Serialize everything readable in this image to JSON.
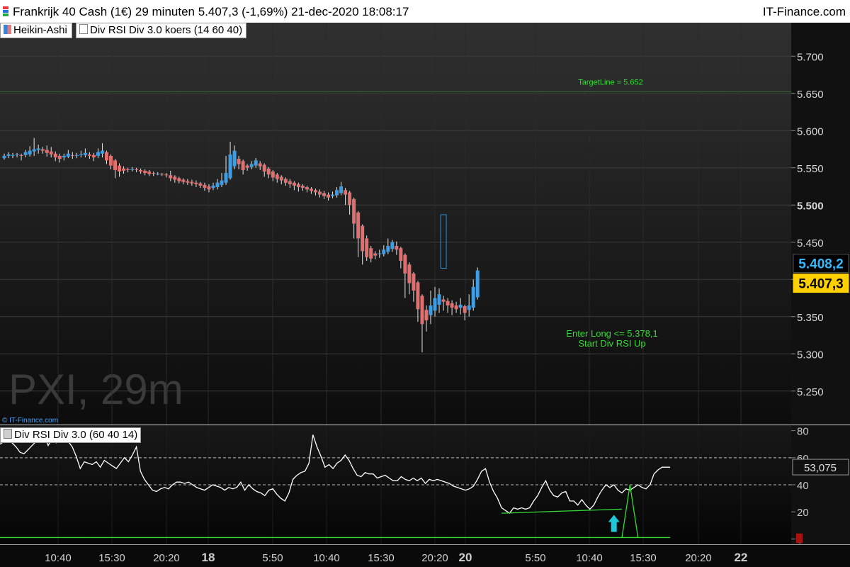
{
  "header": {
    "title": "Frankrijk 40 Cash (1€) 29 minuten 5.407,3 (-1,69%) 21-dec-2020 18:08:17",
    "brand": "IT-Finance.com"
  },
  "legend": {
    "heikin": "Heikin-Ashi",
    "divrsi_main": "Div RSI Div 3.0 koers (14 60 40)",
    "divrsi_sub": "Div RSI Div 3.0 (60 40 14)"
  },
  "watermark": "PXI, 29m",
  "copyright": "© IT-Finance.com",
  "colors": {
    "up": "#3d9ee6",
    "down": "#e07070",
    "wick": "#e6e6e6",
    "signal": "#33dd33",
    "current_price_bg": "#ffd000",
    "last_price_fg": "#33bbff",
    "arrow": "#1ec8d8",
    "rsi_line": "#ffffff"
  },
  "chart_data": [
    {
      "type": "candlestick",
      "title": "Frankrijk 40 Cash (1€) 29 minuten",
      "ylim": [
        5.205,
        5.745
      ],
      "yticks": [
        {
          "v": 5.25,
          "label": "5.250"
        },
        {
          "v": 5.3,
          "label": "5.300"
        },
        {
          "v": 5.35,
          "label": "5.350"
        },
        {
          "v": 5.4,
          "label": ""
        },
        {
          "v": 5.45,
          "label": "5.450"
        },
        {
          "v": 5.5,
          "label": "5.500"
        },
        {
          "v": 5.55,
          "label": "5.550"
        },
        {
          "v": 5.6,
          "label": "5.600"
        },
        {
          "v": 5.65,
          "label": "5.650"
        },
        {
          "v": 5.7,
          "label": "5.700"
        }
      ],
      "xticks": [
        "10:40",
        "15:30",
        "20:20",
        "18",
        "5:50",
        "10:40",
        "15:30",
        "20:20",
        "20",
        "5:50",
        "10:40",
        "15:30",
        "20:20",
        "22"
      ],
      "bold_xticks": [
        "18",
        "20",
        "22"
      ],
      "candles": [
        [
          5563,
          5566,
          5561,
          5569
        ],
        [
          5566,
          5568,
          5563,
          5571
        ],
        [
          5566,
          5567,
          5563,
          5570
        ],
        [
          5567,
          5568,
          5564,
          5570
        ],
        [
          5567,
          5566,
          5560,
          5569
        ],
        [
          5567,
          5571,
          5564,
          5574
        ],
        [
          5568,
          5573,
          5565,
          5579
        ],
        [
          5572,
          5575,
          5566,
          5590
        ],
        [
          5574,
          5576,
          5569,
          5581
        ],
        [
          5575,
          5573,
          5569,
          5578
        ],
        [
          5574,
          5570,
          5565,
          5580
        ],
        [
          5572,
          5568,
          5564,
          5578
        ],
        [
          5569,
          5564,
          5559,
          5572
        ],
        [
          5566,
          5562,
          5557,
          5569
        ],
        [
          5564,
          5566,
          5560,
          5569
        ],
        [
          5565,
          5569,
          5563,
          5574
        ],
        [
          5567,
          5566,
          5562,
          5571
        ],
        [
          5566,
          5567,
          5563,
          5570
        ],
        [
          5567,
          5568,
          5564,
          5573
        ],
        [
          5567,
          5570,
          5564,
          5576
        ],
        [
          5568,
          5566,
          5562,
          5571
        ],
        [
          5567,
          5564,
          5559,
          5570
        ],
        [
          5566,
          5571,
          5563,
          5576
        ],
        [
          5569,
          5573,
          5564,
          5583
        ],
        [
          5571,
          5560,
          5555,
          5573
        ],
        [
          5566,
          5553,
          5548,
          5568
        ],
        [
          5560,
          5547,
          5536,
          5562
        ],
        [
          5553,
          5545,
          5538,
          5556
        ],
        [
          5549,
          5546,
          5542,
          5552
        ],
        [
          5548,
          5547,
          5544,
          5550
        ],
        [
          5547,
          5548,
          5545,
          5551
        ],
        [
          5548,
          5547,
          5544,
          5550
        ],
        [
          5547,
          5545,
          5542,
          5549
        ],
        [
          5546,
          5543,
          5540,
          5548
        ],
        [
          5545,
          5542,
          5539,
          5547
        ],
        [
          5543,
          5542,
          5539,
          5545
        ],
        [
          5542,
          5542,
          5540,
          5544
        ],
        [
          5542,
          5541,
          5539,
          5543
        ],
        [
          5541,
          5540,
          5537,
          5543
        ],
        [
          5540,
          5536,
          5532,
          5546
        ],
        [
          5538,
          5534,
          5530,
          5540
        ],
        [
          5536,
          5532,
          5529,
          5538
        ],
        [
          5534,
          5531,
          5528,
          5536
        ],
        [
          5532,
          5530,
          5527,
          5535
        ],
        [
          5531,
          5529,
          5526,
          5534
        ],
        [
          5530,
          5528,
          5524,
          5533
        ],
        [
          5529,
          5526,
          5523,
          5531
        ],
        [
          5527,
          5523,
          5519,
          5530
        ],
        [
          5525,
          5521,
          5517,
          5528
        ],
        [
          5523,
          5526,
          5520,
          5530
        ],
        [
          5524,
          5530,
          5521,
          5535
        ],
        [
          5527,
          5533,
          5524,
          5543
        ],
        [
          5530,
          5543,
          5527,
          5566
        ],
        [
          5536,
          5568,
          5534,
          5585
        ],
        [
          5552,
          5573,
          5548,
          5580
        ],
        [
          5562,
          5555,
          5548,
          5566
        ],
        [
          5559,
          5547,
          5541,
          5561
        ],
        [
          5553,
          5550,
          5546,
          5555
        ],
        [
          5551,
          5555,
          5548,
          5559
        ],
        [
          5553,
          5560,
          5550,
          5563
        ],
        [
          5556,
          5552,
          5547,
          5559
        ],
        [
          5554,
          5545,
          5538,
          5556
        ],
        [
          5549,
          5541,
          5536,
          5551
        ],
        [
          5545,
          5537,
          5532,
          5547
        ],
        [
          5541,
          5535,
          5530,
          5543
        ],
        [
          5538,
          5533,
          5528,
          5540
        ],
        [
          5535,
          5530,
          5526,
          5537
        ],
        [
          5532,
          5528,
          5523,
          5535
        ],
        [
          5530,
          5526,
          5520,
          5532
        ],
        [
          5528,
          5524,
          5518,
          5530
        ],
        [
          5526,
          5523,
          5519,
          5528
        ],
        [
          5524,
          5521,
          5517,
          5526
        ],
        [
          5522,
          5519,
          5515,
          5524
        ],
        [
          5520,
          5517,
          5513,
          5522
        ],
        [
          5518,
          5514,
          5510,
          5521
        ],
        [
          5516,
          5512,
          5508,
          5519
        ],
        [
          5514,
          5510,
          5506,
          5517
        ],
        [
          5512,
          5514,
          5509,
          5518
        ],
        [
          5513,
          5520,
          5510,
          5524
        ],
        [
          5516,
          5525,
          5513,
          5531
        ],
        [
          5520,
          5514,
          5500,
          5523
        ],
        [
          5517,
          5500,
          5487,
          5519
        ],
        [
          5508,
          5475,
          5455,
          5510
        ],
        [
          5490,
          5455,
          5430,
          5492
        ],
        [
          5472,
          5438,
          5420,
          5474
        ],
        [
          5455,
          5430,
          5425,
          5459
        ],
        [
          5442,
          5428,
          5423,
          5445
        ],
        [
          5435,
          5432,
          5427,
          5438
        ],
        [
          5434,
          5435,
          5429,
          5440
        ],
        [
          5434,
          5440,
          5431,
          5446
        ],
        [
          5437,
          5445,
          5434,
          5455
        ],
        [
          5441,
          5450,
          5437,
          5453
        ],
        [
          5445,
          5440,
          5433,
          5451
        ],
        [
          5442,
          5425,
          5415,
          5444
        ],
        [
          5433,
          5408,
          5375,
          5435
        ],
        [
          5420,
          5395,
          5380,
          5423
        ],
        [
          5408,
          5385,
          5370,
          5410
        ],
        [
          5396,
          5360,
          5343,
          5398
        ],
        [
          5378,
          5340,
          5302,
          5380
        ],
        [
          5359,
          5345,
          5330,
          5365
        ],
        [
          5352,
          5365,
          5340,
          5385
        ],
        [
          5358,
          5375,
          5350,
          5390
        ],
        [
          5366,
          5380,
          5355,
          5388
        ],
        [
          5373,
          5370,
          5358,
          5378
        ],
        [
          5371,
          5365,
          5355,
          5375
        ],
        [
          5368,
          5362,
          5352,
          5372
        ],
        [
          5365,
          5360,
          5355,
          5370
        ],
        [
          5362,
          5366,
          5353,
          5375
        ],
        [
          5364,
          5355,
          5345,
          5366
        ],
        [
          5359,
          5365,
          5350,
          5380
        ],
        [
          5362,
          5390,
          5358,
          5400
        ],
        [
          5376,
          5412,
          5373,
          5416
        ]
      ],
      "target_line": {
        "value": 5.652,
        "label": "TargetLine = 5.652"
      },
      "div_box": {
        "top": 5.487,
        "bottom": 5.415,
        "candle_index": 103
      },
      "signal_labels": [
        "Enter Long <= 5.378,1",
        "Start Div RSI Up"
      ],
      "price_labels": [
        {
          "value": 5.4082,
          "label": "5.408,2",
          "style": "last"
        },
        {
          "value": 5.4073,
          "label": "5.407,3",
          "style": "current"
        }
      ]
    },
    {
      "type": "line",
      "title": "Div RSI Div 3.0 (60 40 14)",
      "ylim": [
        -4,
        84
      ],
      "yticks": [
        {
          "v": 80,
          "label": "80"
        },
        {
          "v": 60,
          "label": "60"
        },
        {
          "v": 40,
          "label": "40"
        },
        {
          "v": 20,
          "label": "20"
        },
        {
          "v": 0,
          "label": "0"
        }
      ],
      "levels": [
        60,
        40
      ],
      "last_value": "53,075",
      "series": [
        {
          "values": [
            70,
            72,
            73,
            71,
            68,
            64,
            63,
            66,
            69,
            72,
            74,
            77,
            69,
            74,
            71,
            74,
            76,
            72,
            68,
            61,
            52,
            57,
            56,
            55,
            57,
            53,
            58,
            56,
            54,
            52,
            56,
            60,
            57,
            62,
            68,
            50,
            44,
            40,
            36,
            35,
            37,
            38,
            37,
            40,
            42,
            42,
            41,
            42,
            40,
            38,
            37,
            36,
            38,
            40,
            39,
            38,
            36,
            38,
            37,
            38,
            42,
            36,
            40,
            37,
            35,
            34,
            32,
            36,
            37,
            33,
            30,
            28,
            34,
            44,
            47,
            49,
            50,
            56,
            77,
            68,
            61,
            53,
            55,
            52,
            56,
            58,
            62,
            58,
            52,
            47,
            46,
            49,
            48,
            48,
            45,
            46,
            47,
            45,
            43,
            43,
            46,
            44,
            43,
            45,
            43,
            45,
            41,
            44,
            43,
            44,
            43,
            42,
            41,
            39,
            38,
            37,
            36,
            37,
            39,
            44,
            50,
            52,
            42,
            35,
            30,
            23,
            21,
            19,
            23,
            22,
            23,
            22,
            23,
            28,
            32,
            38,
            43,
            36,
            32,
            31,
            34,
            35,
            28,
            28,
            25,
            29,
            25,
            22,
            25,
            31,
            36,
            40,
            38,
            40,
            36,
            34,
            37,
            36,
            38,
            40,
            38,
            37,
            40,
            48,
            51,
            53,
            53,
            53
          ]
        }
      ],
      "div_line": {
        "from_index": 125,
        "from": 19,
        "to_index": 155,
        "to": 22
      },
      "signal_spike": {
        "index": 157,
        "value": 40
      },
      "baseline": 1
    }
  ]
}
